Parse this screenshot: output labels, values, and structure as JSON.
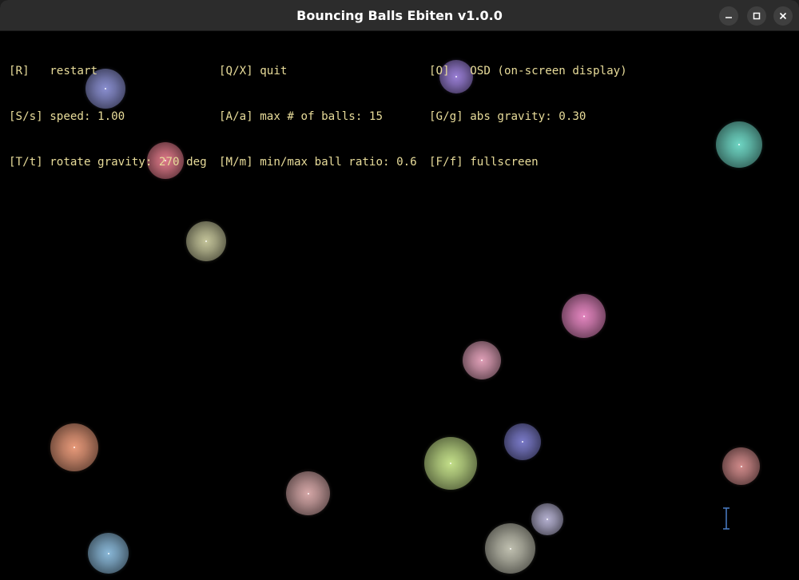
{
  "window": {
    "title": "Bouncing Balls Ebiten v1.0.0",
    "controls": [
      "minimize-icon",
      "maximize-icon",
      "close-icon"
    ]
  },
  "osd": {
    "col1": {
      "line1": "[R]   restart",
      "line2": "[S/s] speed: 1.00",
      "line3": "[T/t] rotate gravity: 270 deg"
    },
    "col2": {
      "line1": "[Q/X] quit",
      "line2": "[A/a] max # of balls: 15",
      "line3": "[M/m] min/max ball ratio: 0.6"
    },
    "col3": {
      "line1": "[O]   OSD (on-screen display)",
      "line2": "[G/g] abs gravity: 0.30",
      "line3": "[F/f] fullscreen"
    },
    "text_color": "#e8dc9a"
  },
  "balls": [
    {
      "color": "#8a8fd0"
    },
    {
      "color": "#9a7fd6"
    },
    {
      "color": "#e07a8a"
    },
    {
      "color": "#6fd6c4"
    },
    {
      "color": "#c4c49a"
    },
    {
      "color": "#e486c0"
    },
    {
      "color": "#e0a0b8"
    },
    {
      "color": "#e89a7a"
    },
    {
      "color": "#7a7ac8"
    },
    {
      "color": "#c4e08a"
    },
    {
      "color": "#d6a8a8"
    },
    {
      "color": "#d08a8a"
    },
    {
      "color": "#b4b0d0"
    },
    {
      "color": "#8ab8d8"
    },
    {
      "color": "#c0c0b0"
    }
  ],
  "cursor": "text-cursor-icon"
}
